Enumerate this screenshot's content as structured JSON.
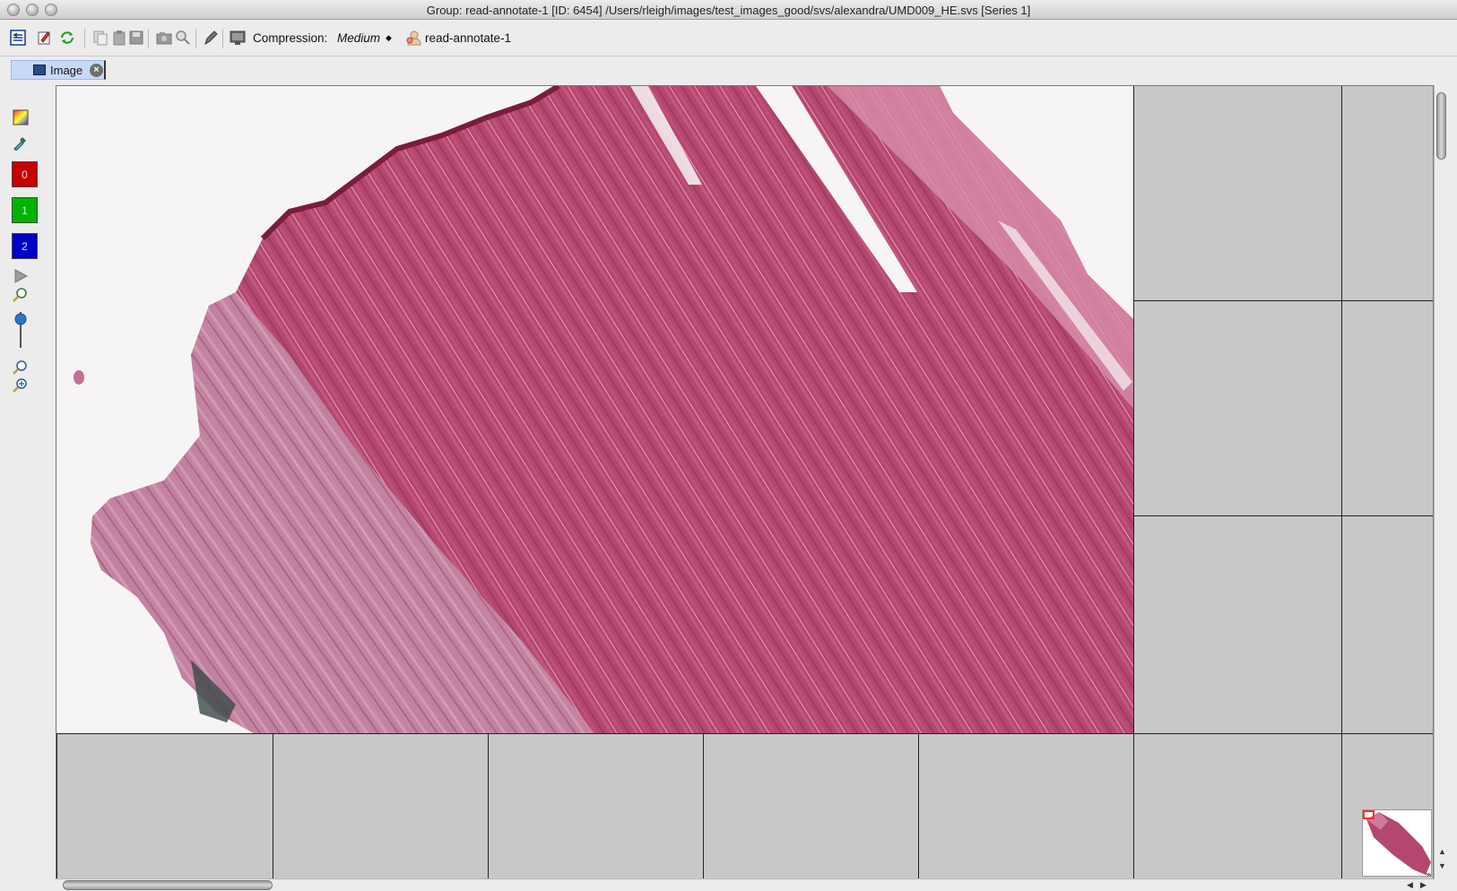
{
  "window": {
    "title": "Group: read-annotate-1 [ID: 6454] /Users/rleigh/images/test_images_good/svs/alexandra/UMD009_HE.svs [Series 1]"
  },
  "toolbar": {
    "compression_label": "Compression:",
    "compression_value": "Medium",
    "group_label": "read-annotate-1",
    "icons": [
      "options-icon",
      "edit-icon",
      "refresh-icon",
      "copy-icon",
      "paste-icon",
      "save-icon",
      "camera-icon",
      "zoom-icon",
      "pen-icon",
      "display-icon",
      "group-icon"
    ]
  },
  "tabs": [
    {
      "label": "Image",
      "close": "×"
    }
  ],
  "leftbar": {
    "channels": [
      {
        "label": "0",
        "color": "#c80000"
      },
      {
        "label": "1",
        "color": "#00b400"
      },
      {
        "label": "2",
        "color": "#0000c8"
      }
    ],
    "icons": [
      "color-palette-icon",
      "eyedropper-icon",
      "play-icon",
      "zoom-fit-icon",
      "zoom-slider-icon",
      "zoom-in-icon",
      "zoom-out-icon"
    ]
  },
  "viewer": {
    "colors": {
      "tile_empty": "#c8c8c8",
      "tissue": "#b2476e",
      "background": "#f7f4f5"
    }
  }
}
